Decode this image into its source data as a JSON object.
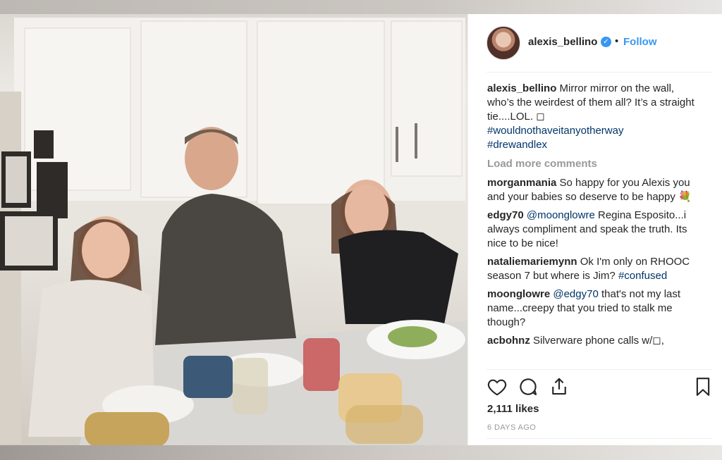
{
  "post": {
    "username": "alexis_bellino",
    "separator": "•",
    "follow_label": "Follow",
    "caption": {
      "user": "alexis_bellino",
      "text": " Mirror mirror on the wall, who’s the weirdest of them all? It’s a straight tie....LOL. ◻",
      "hashtag_1": "#wouldnothaveitanyotherway",
      "hashtag_2": "#drewandlex"
    },
    "load_more_label": "Load more comments",
    "comments": [
      {
        "user": "morganmania",
        "text": " So happy for you Alexis you and your babies so deserve to be happy ",
        "emoji": "💐"
      },
      {
        "user": "edgy70",
        "mention": "@moonglowre",
        "text": " Regina Esposito...i always compliment and speak the truth. Its nice to be nice!"
      },
      {
        "user": "nataliemariemynn",
        "text": " Ok I'm only on RHOOC season 7 but where is Jim? ",
        "hashtag": "#confused"
      },
      {
        "user": "moonglowre",
        "mention": "@edgy70",
        "text": " that's not my last name...creepy that you tried to stalk me though?"
      },
      {
        "user": "acbohnz",
        "text": " Silverware phone calls w/◻,"
      }
    ],
    "likes": "2,111 likes",
    "time": "6 DAYS AGO"
  },
  "icons": {
    "verified": "verified-badge-icon",
    "like": "heart-icon",
    "comment": "comment-bubble-icon",
    "share": "share-icon",
    "save": "bookmark-icon"
  },
  "colors": {
    "link": "#3897f0",
    "hashtag": "#003569",
    "muted": "#999999",
    "text": "#262626"
  }
}
